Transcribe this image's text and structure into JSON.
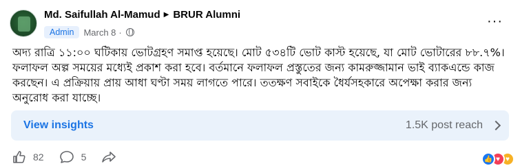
{
  "post": {
    "author": "Md. Saifullah Al-Mamud",
    "group": "BRUR Alumni",
    "role_badge": "Admin",
    "date": "March 8",
    "text": "অদ্য রাত্রি ১১:০০ ঘটিকায় ভোটগ্রহণ সমাপ্ত হয়েছে। মোট ৫৩৪টি ভোট কাস্ট হয়েছে, যা মোট ভোটারের ৮৮.৭%। ফলাফল অল্প সময়ের মধ্যেই প্রকাশ করা হবে। বর্তমানে ফলাফল প্রস্তুতের জন্য কামরুজ্জামান ভাই ব্যাকএন্ডে কাজ করছেন। এ প্রক্রিয়ায় প্রায় আধা ঘণ্টা সময় লাগতে পারে। ততক্ষণ সবাইকে ধৈর্যসহকারে অপেক্ষা করার জন্য অনুরোধ করা যাচ্ছে।"
  },
  "insights": {
    "link_label": "View insights",
    "reach": "1.5K post reach"
  },
  "actions": {
    "like_count": "82",
    "comment_count": "5"
  },
  "icons": [
    "avatar",
    "arrow-right-icon",
    "globe-icon",
    "more-icon",
    "chevron-right-icon",
    "like-icon",
    "comment-icon",
    "share-icon",
    "like-reaction-icon",
    "love-reaction-icon",
    "care-reaction-icon"
  ],
  "colors": {
    "accent": "#1b74e4",
    "insights_bg": "#eaf2fb",
    "muted": "#65676b"
  }
}
